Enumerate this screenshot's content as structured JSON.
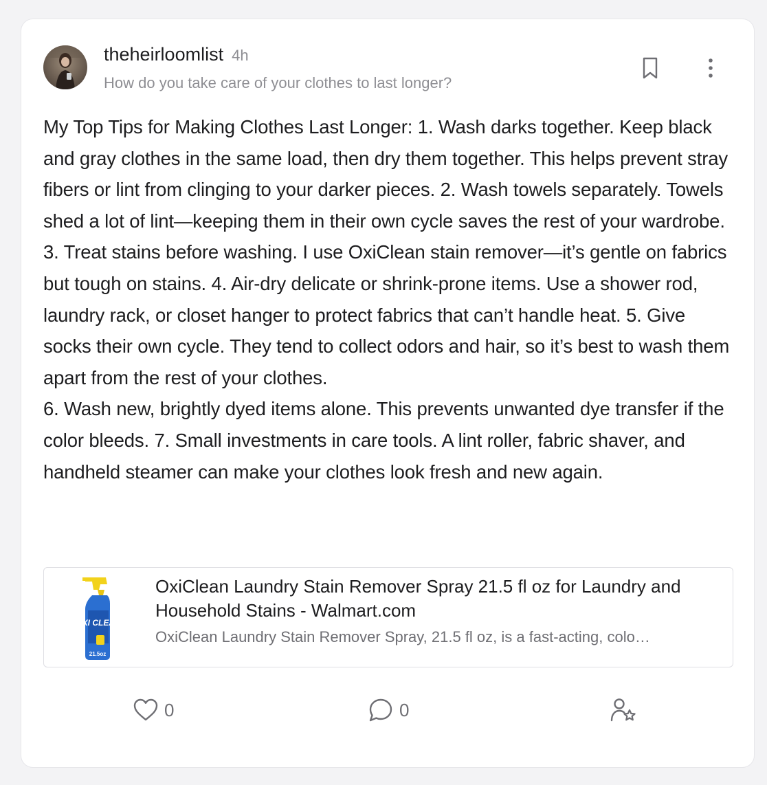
{
  "post": {
    "author": "theheirloomlist",
    "time": "4h",
    "context": "How do you take care of your clothes to last longer?",
    "body": "My Top Tips for Making Clothes Last Longer: 1. Wash darks together. Keep black and gray clothes in the same load, then dry them together. This helps prevent stray fibers or lint from clinging to your darker pieces. 2. Wash towels separately. Towels shed a lot of lint—keeping them in their own cycle saves the rest of your wardrobe. 3. Treat stains before washing. I use OxiClean stain remover—it’s gentle on fabrics but tough on stains. 4. Air-dry delicate or shrink-prone items. Use a shower rod, laundry rack, or closet hanger to protect fabrics that can’t handle heat. 5. Give socks their own cycle. They tend to collect odors and hair, so it’s best to wash them apart from the rest of your clothes.\n6. Wash new, brightly dyed items alone. This prevents unwanted dye transfer if the color bleeds. 7. Small investments in care tools. A lint roller, fabric shaver, and handheld steamer can make your clothes look fresh and new again."
  },
  "link_preview": {
    "title": "OxiClean Laundry Stain Remover Spray 21.5 fl oz for Laundry and Household Stains - Walmart.com",
    "description": "OxiClean Laundry Stain Remover Spray, 21.5 fl oz, is a fast-acting, colo…",
    "image_label": "OXI CLEAN",
    "image_size_label": "21.5oz"
  },
  "actions": {
    "likes": "0",
    "comments": "0"
  },
  "icons": {
    "bookmark": "bookmark-icon",
    "more": "more-vertical-icon",
    "like": "heart-icon",
    "comment": "comment-icon",
    "follow": "user-star-icon"
  },
  "colors": {
    "text": "#1d1d1f",
    "muted": "#8e8e93",
    "card_border": "#e6e6ea",
    "background": "#f3f3f5"
  }
}
